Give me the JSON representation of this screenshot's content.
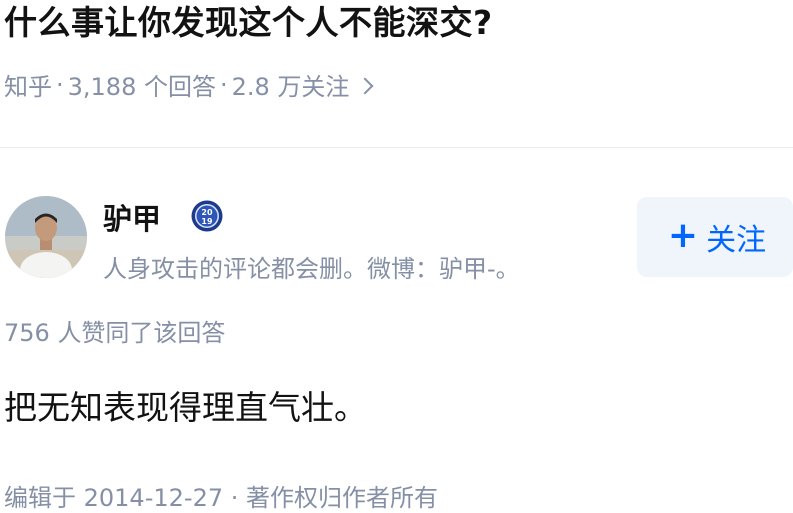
{
  "question": {
    "title": "什么事让你发现这个人不能深交?",
    "source": "知乎",
    "separator": "·",
    "answers_count": "3,188 个回答",
    "followers_count": "2.8 万关注"
  },
  "author": {
    "name": "驴甲",
    "badge_year_top": "20",
    "badge_year_bottom": "19",
    "bio": "人身攻击的评论都会删。微博：驴甲-。"
  },
  "follow_button": {
    "plus": "+",
    "label": "关注"
  },
  "answer": {
    "upvotes": "756 人赞同了该回答",
    "content": "把无知表现得理直气壮。",
    "footer": "编辑于 2014-12-27 · 著作权归作者所有"
  },
  "colors": {
    "accent": "#0066ff",
    "meta": "#8590a6",
    "text": "#121212",
    "follow_bg": "#f0f5fc",
    "badge": "#1e3a8a"
  },
  "icons": [
    "chevron-right-icon",
    "year-badge-icon",
    "plus-icon"
  ]
}
